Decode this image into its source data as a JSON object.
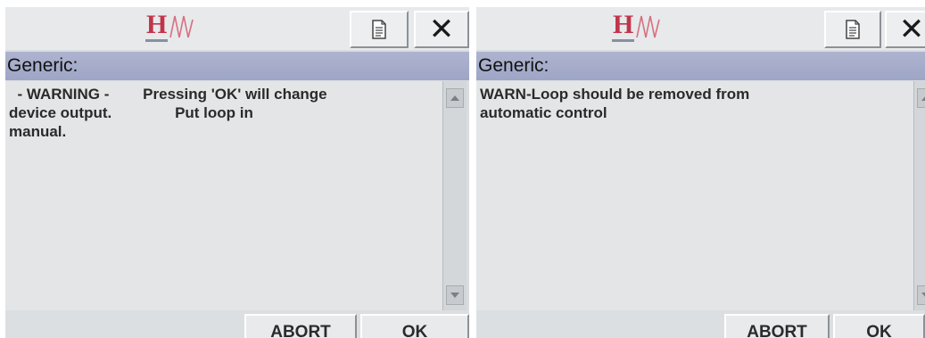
{
  "screens": [
    {
      "title": "Generic:",
      "message_lines": [
        "  - WARNING -        Pressing 'OK' will change",
        "device output.               Put loop in",
        "manual."
      ],
      "buttons": {
        "abort": "ABORT",
        "ok": "OK"
      },
      "icons": {
        "logo": "hw-logo",
        "document": "document-icon",
        "close": "close-icon"
      }
    },
    {
      "title": "Generic:",
      "message_lines": [
        "WARN-Loop should be removed from",
        "automatic control",
        ""
      ],
      "buttons": {
        "abort": "ABORT",
        "ok": "OK"
      },
      "icons": {
        "logo": "hw-logo",
        "document": "document-icon",
        "close": "close-icon"
      }
    }
  ],
  "logo_letter": "H",
  "close_glyph": "✕",
  "colors": {
    "title_bar": "#a5abc9",
    "logo": "#c1344a",
    "background": "#d9dde0"
  }
}
